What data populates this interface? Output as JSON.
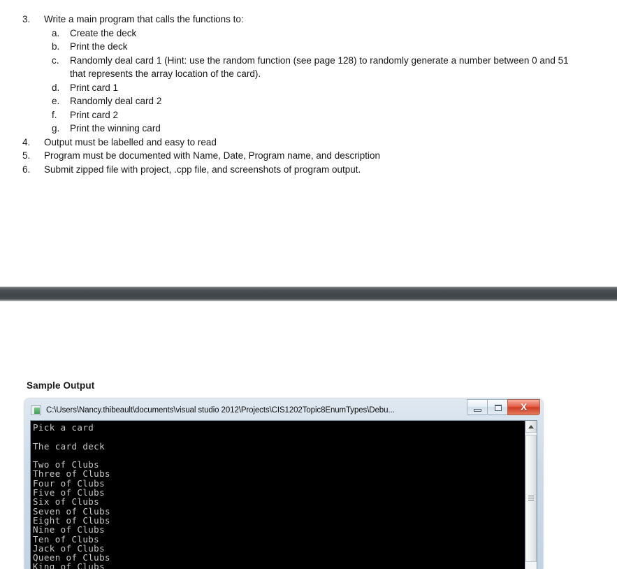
{
  "document": {
    "items": [
      {
        "level": 1,
        "marker": "3.",
        "text": "Write a main program that calls the functions to:"
      },
      {
        "level": 2,
        "marker": "a.",
        "text": "Create the deck"
      },
      {
        "level": 2,
        "marker": "b.",
        "text": "Print the deck"
      },
      {
        "level": 2,
        "marker": "c.",
        "text": "Randomly deal card 1 (Hint: use the random function (see page 128) to randomly generate a number between 0 and 51 that represents the array location of the card)."
      },
      {
        "level": 2,
        "marker": "d.",
        "text": "Print card 1"
      },
      {
        "level": 2,
        "marker": "e.",
        "text": "Randomly deal card 2"
      },
      {
        "level": 2,
        "marker": "f.",
        "text": "Print card 2"
      },
      {
        "level": 2,
        "marker": "g.",
        "text": "Print the winning card"
      },
      {
        "level": 1,
        "marker": "4.",
        "text": "Output must be labelled and easy to read"
      },
      {
        "level": 1,
        "marker": "5.",
        "text": "Program must be documented with Name, Date, Program name, and description"
      },
      {
        "level": 1,
        "marker": "6.",
        "text": "Submit zipped file with project, .cpp file, and screenshots of program output."
      }
    ]
  },
  "sample_output": {
    "heading": "Sample Output"
  },
  "console_window": {
    "title": "C:\\Users\\Nancy.thibeault\\documents\\visual studio 2012\\Projects\\CIS1202Topic8EnumTypes\\Debu...",
    "icon": "console-icon",
    "buttons": {
      "minimize": "minimize-icon",
      "maximize": "maximize-icon",
      "close": "X"
    },
    "lines": [
      "Pick a card",
      "",
      "The card deck",
      "",
      "Two of Clubs",
      "Three of Clubs",
      "Four of Clubs",
      "Five of Clubs",
      "Six of Clubs",
      "Seven of Clubs",
      "Eight of Clubs",
      "Nine of Clubs",
      "Ten of Clubs",
      "Jack of Clubs",
      "Queen of Clubs",
      "King of Clubs"
    ],
    "scrollbar": {
      "up_arrow": "arrow-up-icon",
      "thumb_grip": "grip-icon"
    }
  },
  "colors": {
    "console_background": "#000000",
    "console_text": "#c9c9c9",
    "close_button": "#cf3c22",
    "band": "#3f4548"
  }
}
